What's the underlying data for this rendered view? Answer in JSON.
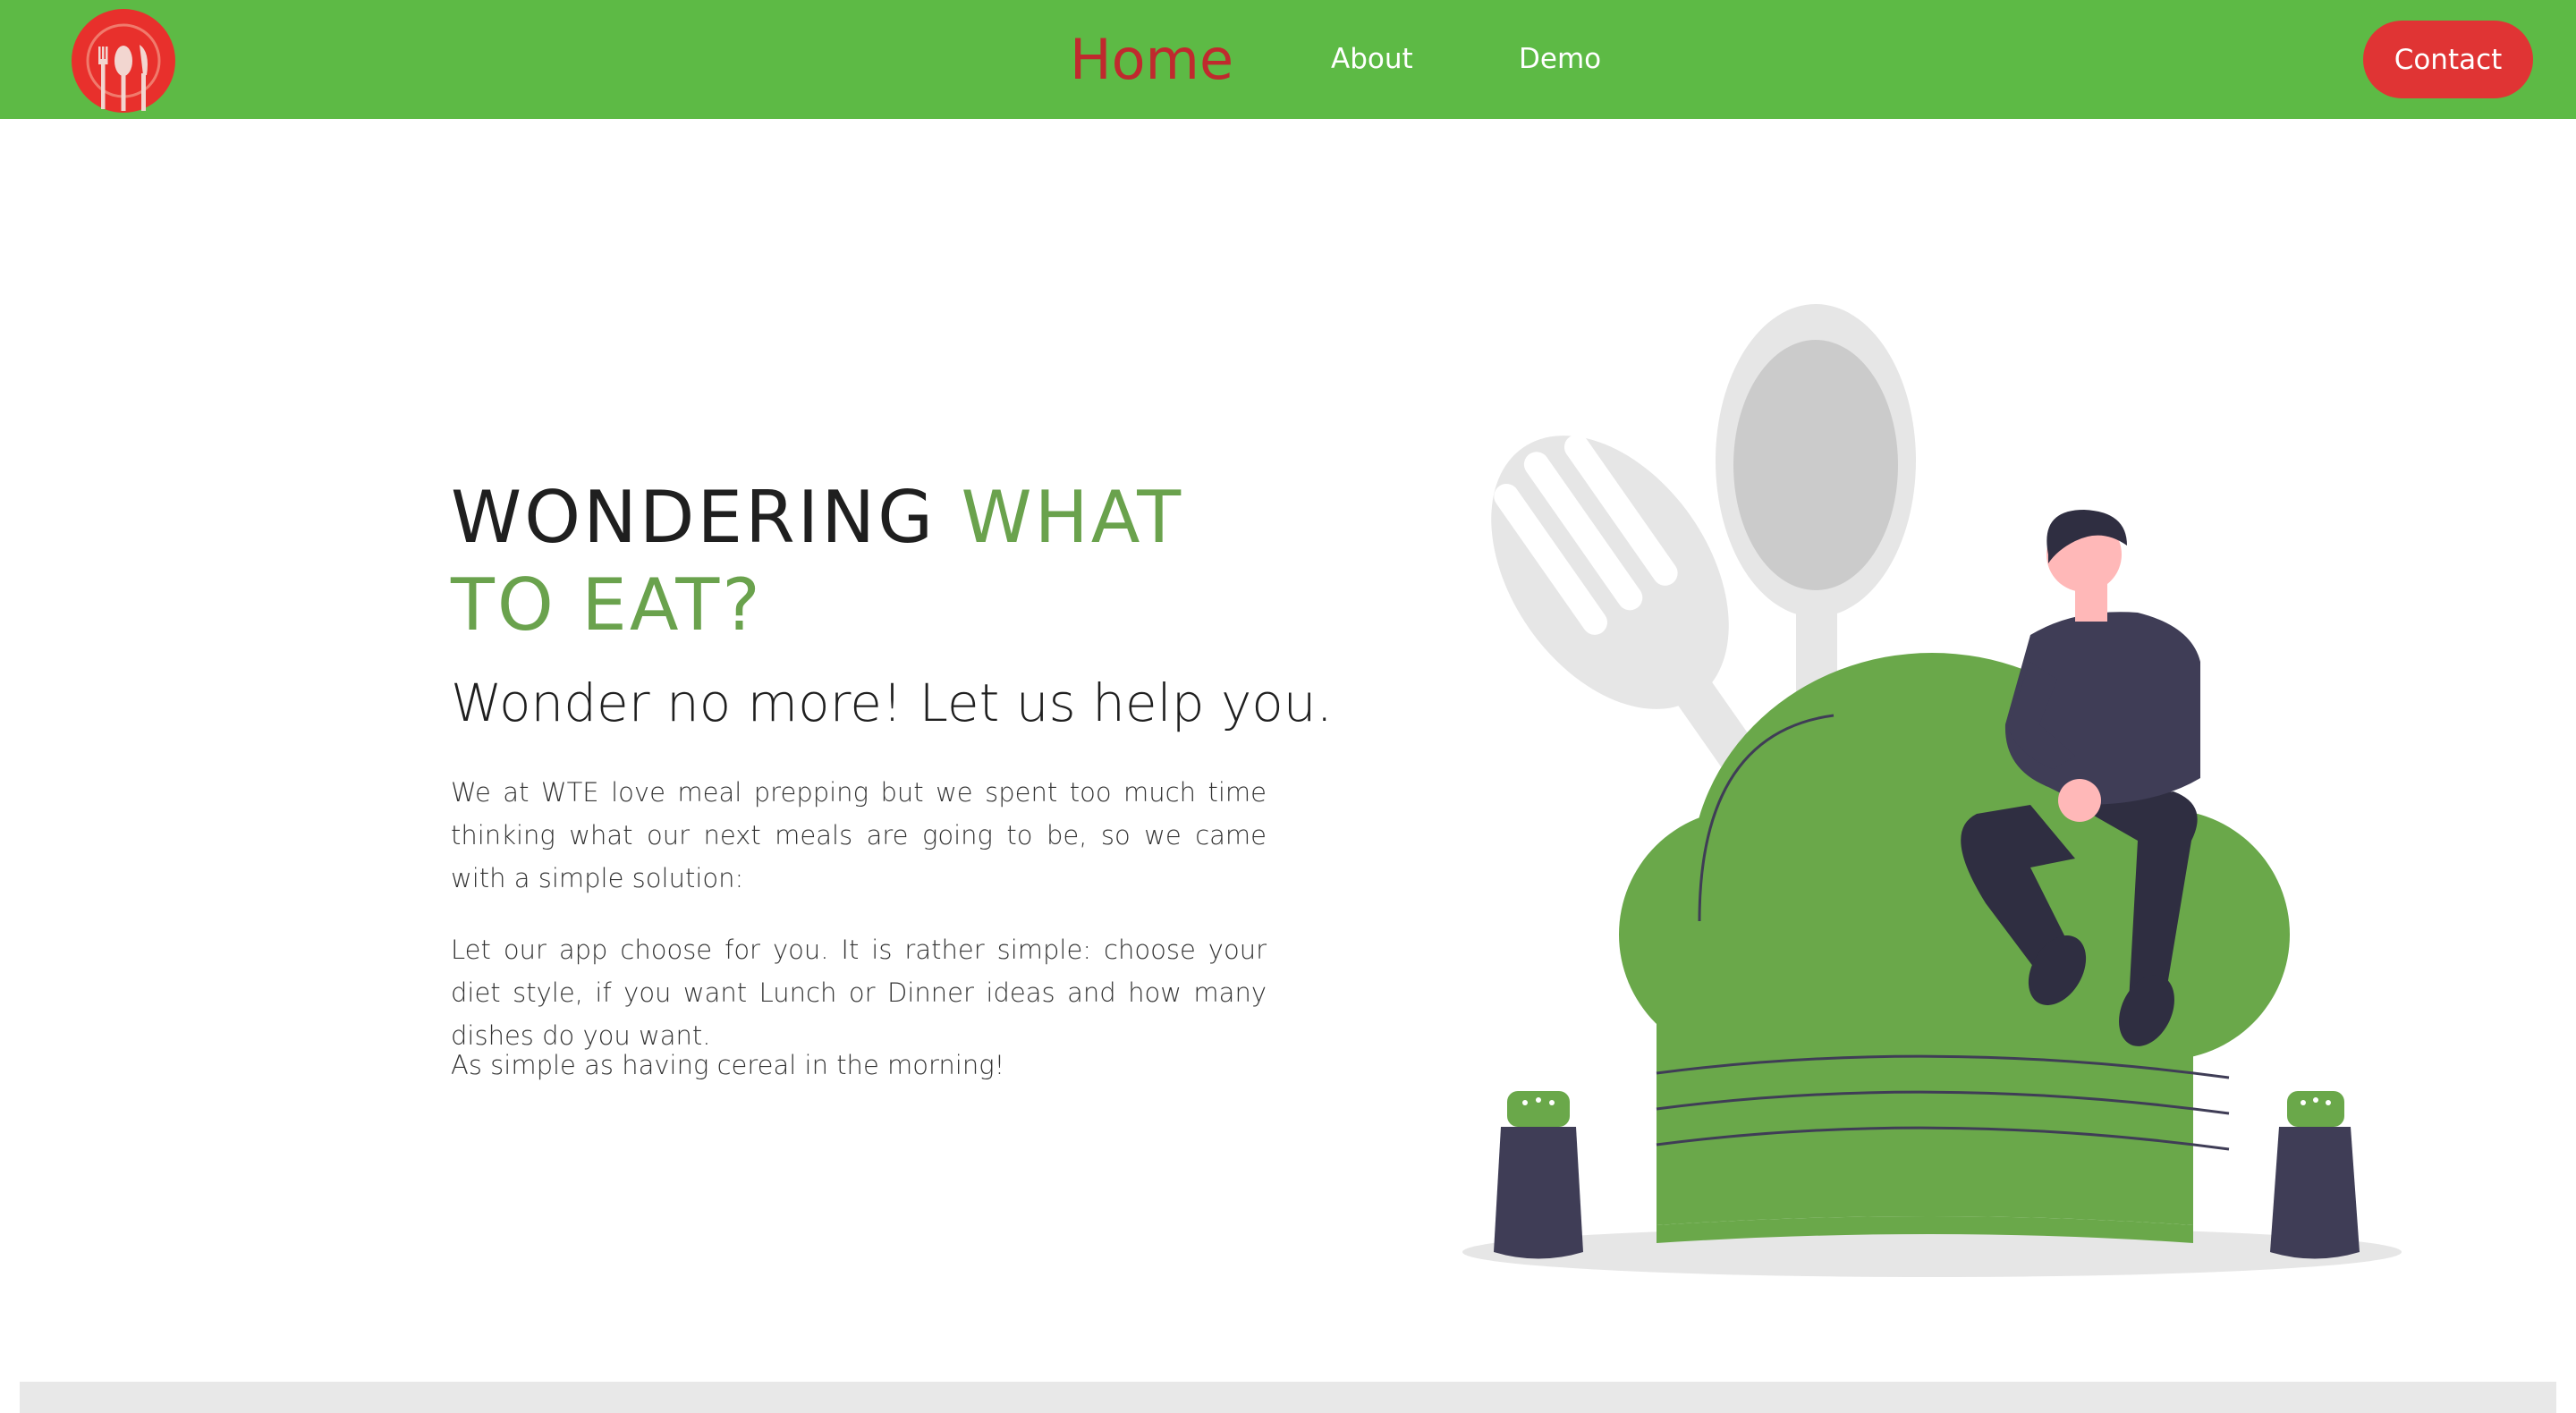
{
  "nav": {
    "logo_icon": "fork-spoon-knife-plate-icon",
    "links": [
      {
        "label": "Home",
        "active": true
      },
      {
        "label": "About",
        "active": false
      },
      {
        "label": "Demo",
        "active": false
      }
    ],
    "contact_label": "Contact"
  },
  "hero": {
    "title_part1": "WONDERING ",
    "title_part2": "WHAT TO EAT?",
    "subtitle": "Wonder no more! Let us help you.",
    "paragraphs": [
      "We at WTE love meal prepping but we spent too much time thinking what our next meals are going to be, so we came with a simple solution:",
      "Let our app choose for you. It is rather simple: choose your diet style, if you want Lunch or Dinner ideas and how many dishes do you want.",
      "As simple as having cereal in the morning!"
    ]
  },
  "colors": {
    "navbar": "#5dba45",
    "accent_green": "#6aa24d",
    "brand_red": "#e03434",
    "home_active": "#c0292e",
    "footer": "#e8e8e8"
  }
}
